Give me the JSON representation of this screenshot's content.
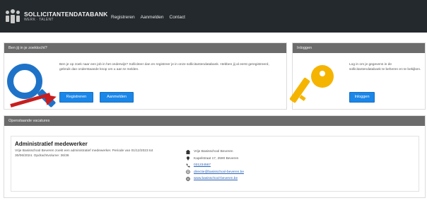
{
  "navbar": {
    "brand_title": "SOLLICITANTENDATABANK",
    "brand_sub": "WERK ∙ TALENT",
    "links": [
      "Registreren",
      "Aanmelden",
      "Contact"
    ]
  },
  "intro_panel": {
    "header": "Ben jij in je zoektocht?",
    "text": "Ben je op zoek naar een job in het onderwijs? Solliciteer dan en registreer je in onze sollicitantendatabank. Hebben jij al eerst geregistreerd, gebruik dan onderstaande knop om u aan te melden.",
    "register_label": "Registreren",
    "vacancies_label": "Aanmelden"
  },
  "login_panel": {
    "header": "Inloggen",
    "text": "Log in om je gegevens in de sollicitantendatabank te beheren en te bekijken.",
    "login_label": "Inloggen"
  },
  "vacancies_panel": {
    "header": "Openstaande vacatures",
    "title": "Administratief medewerker",
    "desc": "Vrije Basisschool Beveren zoekt een administratief medewerker. Periode van 01/12/2023 tot 30/06/2024. Opdrachtvolume: 36/36",
    "contact": {
      "school": "Vrije Basisschool Beveren",
      "address": "Kapelstraat 17, 2590 Beveren",
      "phone": "031234567",
      "email": "directie@basisschool-beveren.be",
      "website": "www.basisschool-beveren.be"
    }
  },
  "colors": {
    "navbar": "#24292d",
    "panel_header": "#6b6b6b",
    "button": "#1a86e8",
    "search_icon": "#1e73c8",
    "key_icon": "#f5b400",
    "arrow": "#c81e1e"
  }
}
